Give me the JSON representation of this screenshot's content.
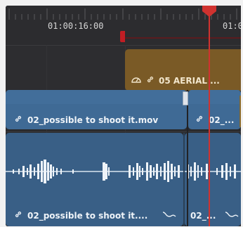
{
  "timeline": {
    "ruler": {
      "timecode_1": "01:00:16:00",
      "timecode_2": "01:0"
    },
    "clips": {
      "video_gold": {
        "title": "05 AERIAL ...",
        "color": "#7a5a26"
      },
      "video_blue_1": {
        "title": "02_possible to shoot it.mov",
        "color": "#3f6a95"
      },
      "video_blue_2": {
        "title": "02_..."
      },
      "audio_1": {
        "title": "02_possible to shoot it....",
        "color": "#395f86"
      },
      "audio_2": {
        "title": "02_..."
      }
    },
    "playhead_color": "#d0322f",
    "icons": [
      "speedometer-icon",
      "link-icon",
      "link-icon",
      "link-icon",
      "link-icon",
      "link-icon",
      "fade-curve-icon",
      "fade-curve-icon"
    ]
  }
}
